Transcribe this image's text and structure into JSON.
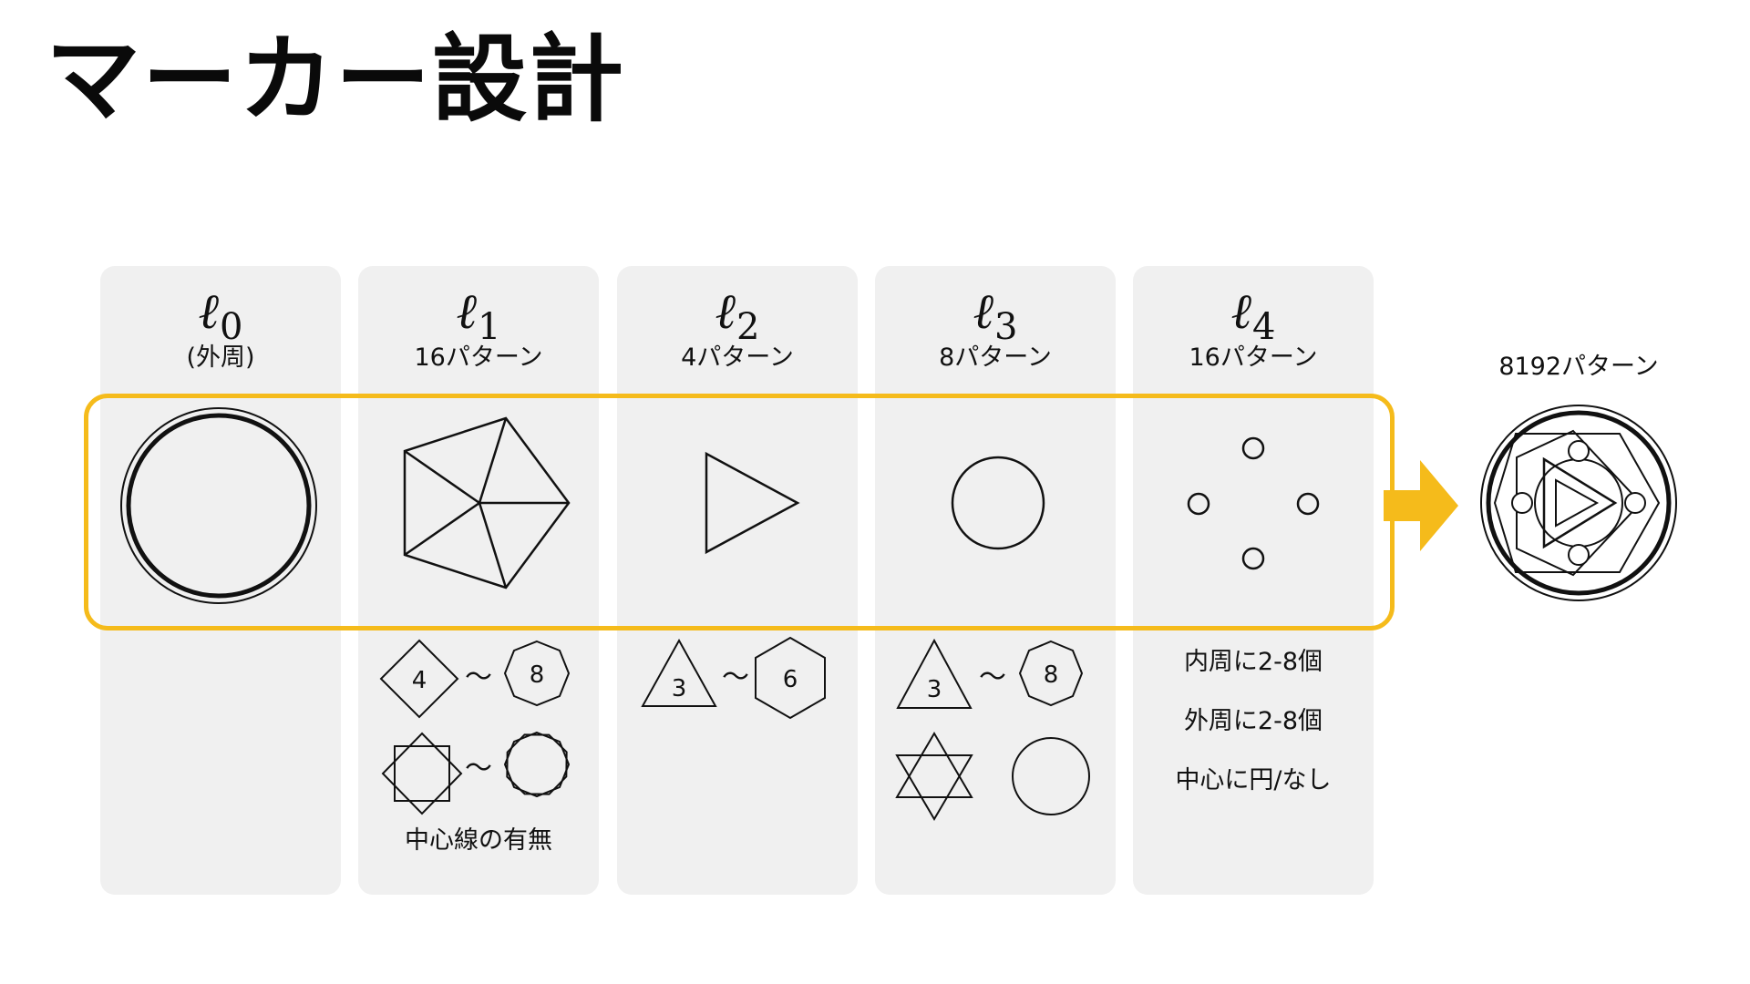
{
  "title": "マーカー設計",
  "accent_color": "#f5bb1b",
  "layers": [
    {
      "symbol": "ℓ",
      "index": "0",
      "count": "(外周)"
    },
    {
      "symbol": "ℓ",
      "index": "1",
      "count": "16パターン"
    },
    {
      "symbol": "ℓ",
      "index": "2",
      "count": "4パターン"
    },
    {
      "symbol": "ℓ",
      "index": "3",
      "count": "8パターン"
    },
    {
      "symbol": "ℓ",
      "index": "4",
      "count": "16パターン"
    }
  ],
  "layer1_variants": {
    "min": "4",
    "max": "8",
    "note": "中心線の有無"
  },
  "layer2_variants": {
    "min": "3",
    "max": "6"
  },
  "layer3_variants": {
    "min": "3",
    "max": "8"
  },
  "layer4_notes": [
    "内周に2-8個",
    "外周に2-8個",
    "中心に円/なし"
  ],
  "tilde": "〜",
  "result": {
    "label": "8192パターン"
  }
}
